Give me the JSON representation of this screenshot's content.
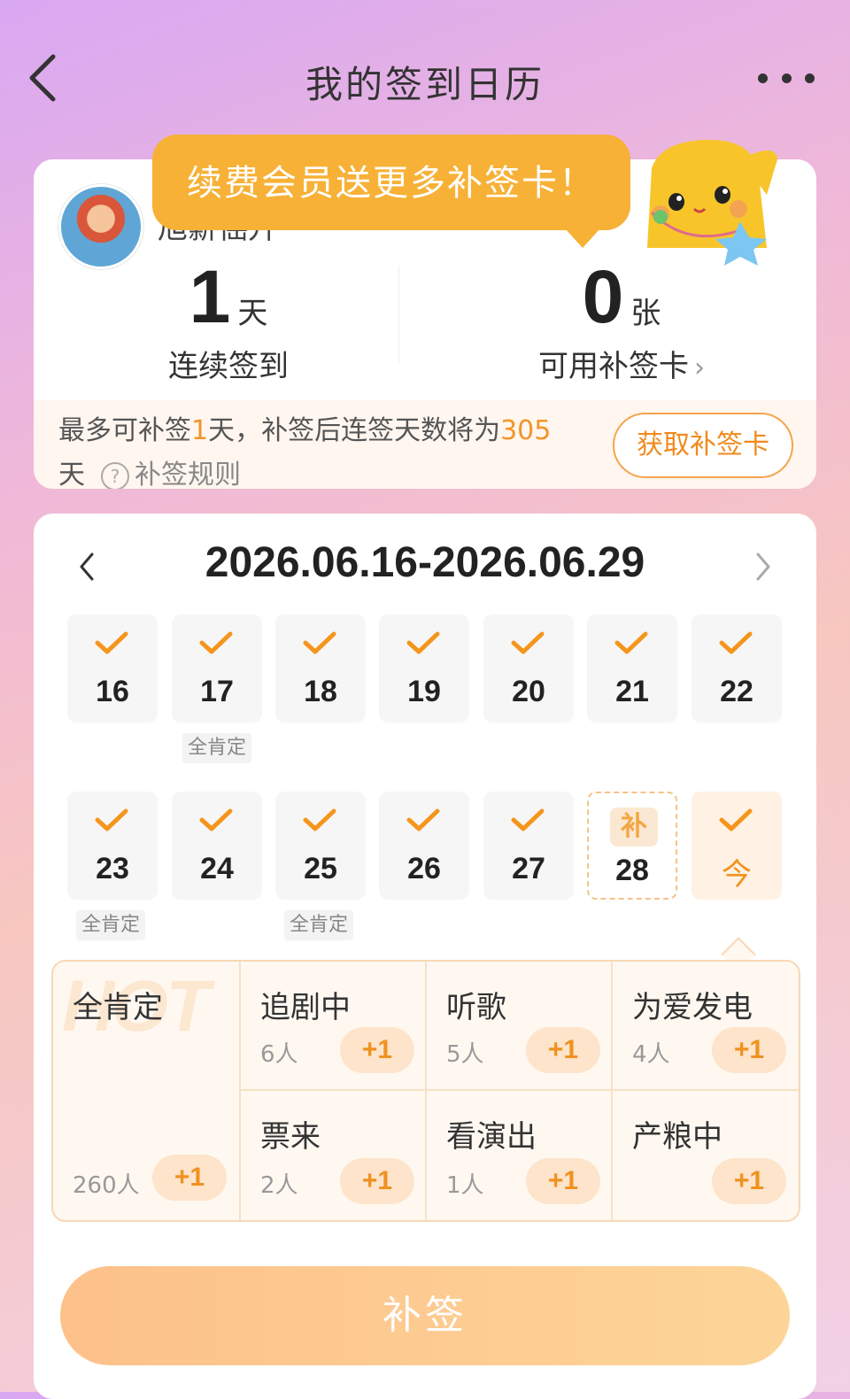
{
  "header": {
    "title": "我的签到日历"
  },
  "user": {
    "name": "旭薪徭升"
  },
  "tooltip": {
    "text": "续费会员送更多补签卡！"
  },
  "stats": {
    "streak": {
      "value": "1",
      "unit": "天",
      "label": "连续签到"
    },
    "cards": {
      "value": "0",
      "unit": "张",
      "label": "可用补签卡"
    }
  },
  "makeup_note": {
    "prefix": "最多可补签",
    "days": "1",
    "mid": "天，补签后连签天数将为",
    "result": "305",
    "suffix": "天",
    "rule_link": "补签规则",
    "get_button": "获取补签卡"
  },
  "calendar": {
    "range": "2026.06.16-2026.06.29",
    "week1": [
      {
        "day": "16",
        "state": "signed"
      },
      {
        "day": "17",
        "state": "signed",
        "tag": "全肯定"
      },
      {
        "day": "18",
        "state": "signed"
      },
      {
        "day": "19",
        "state": "signed"
      },
      {
        "day": "20",
        "state": "signed"
      },
      {
        "day": "21",
        "state": "signed"
      },
      {
        "day": "22",
        "state": "signed"
      }
    ],
    "week2": [
      {
        "day": "23",
        "state": "signed",
        "tag": "全肯定"
      },
      {
        "day": "24",
        "state": "signed"
      },
      {
        "day": "25",
        "state": "signed",
        "tag": "全肯定"
      },
      {
        "day": "26",
        "state": "signed"
      },
      {
        "day": "27",
        "state": "signed"
      },
      {
        "day": "28",
        "state": "makeup",
        "badge": "补"
      },
      {
        "day": "今",
        "state": "today"
      }
    ]
  },
  "moods": {
    "featured": {
      "name": "全肯定",
      "count": "260人",
      "plus": "+1",
      "deco": "HOT"
    },
    "items": [
      {
        "name": "追剧中",
        "count": "6人",
        "plus": "+1"
      },
      {
        "name": "听歌",
        "count": "5人",
        "plus": "+1"
      },
      {
        "name": "为爱发电",
        "count": "4人",
        "plus": "+1"
      },
      {
        "name": "票来",
        "count": "2人",
        "plus": "+1"
      },
      {
        "name": "看演出",
        "count": "1人",
        "plus": "+1"
      },
      {
        "name": "产粮中",
        "count": "",
        "plus": "+1"
      }
    ]
  },
  "submit": {
    "label": "补签"
  },
  "colors": {
    "accent": "#f29527",
    "tooltip": "#f7b137",
    "button": "#fdc18b"
  }
}
